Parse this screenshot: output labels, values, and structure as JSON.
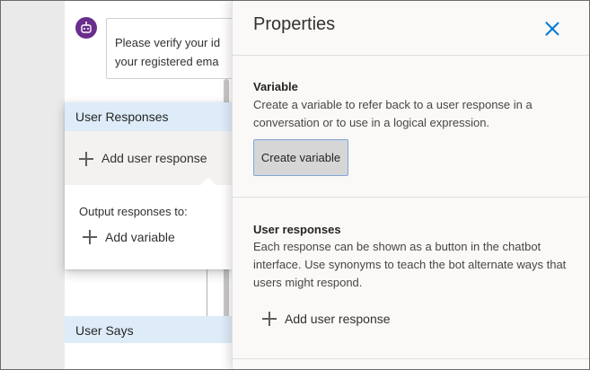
{
  "canvas": {
    "bot_message": {
      "line1": "Please verify your id",
      "line2": "your registered ema"
    },
    "user_responses_card": {
      "title": "User Responses",
      "add_user_response": "Add user response",
      "output_label": "Output responses to:",
      "add_variable": "Add variable"
    },
    "user_says_card": {
      "title": "User Says"
    }
  },
  "properties": {
    "title": "Properties",
    "variable_section": {
      "title": "Variable",
      "description": "Create a variable to refer back to a user response in a conversation or to use in a logical expression.",
      "button_label": "Create variable"
    },
    "user_responses_section": {
      "title": "User responses",
      "description": "Each response can be shown as a button in the chatbot interface. Use synonyms to teach the bot alternate ways that users might respond.",
      "add_label": "Add user response"
    }
  },
  "colors": {
    "accent": "#0078d4",
    "card_header": "#deecf9",
    "bot_avatar": "#6b2d8c"
  },
  "icons": {
    "bot": "robot-icon",
    "close": "close-icon",
    "add": "plus-icon"
  }
}
